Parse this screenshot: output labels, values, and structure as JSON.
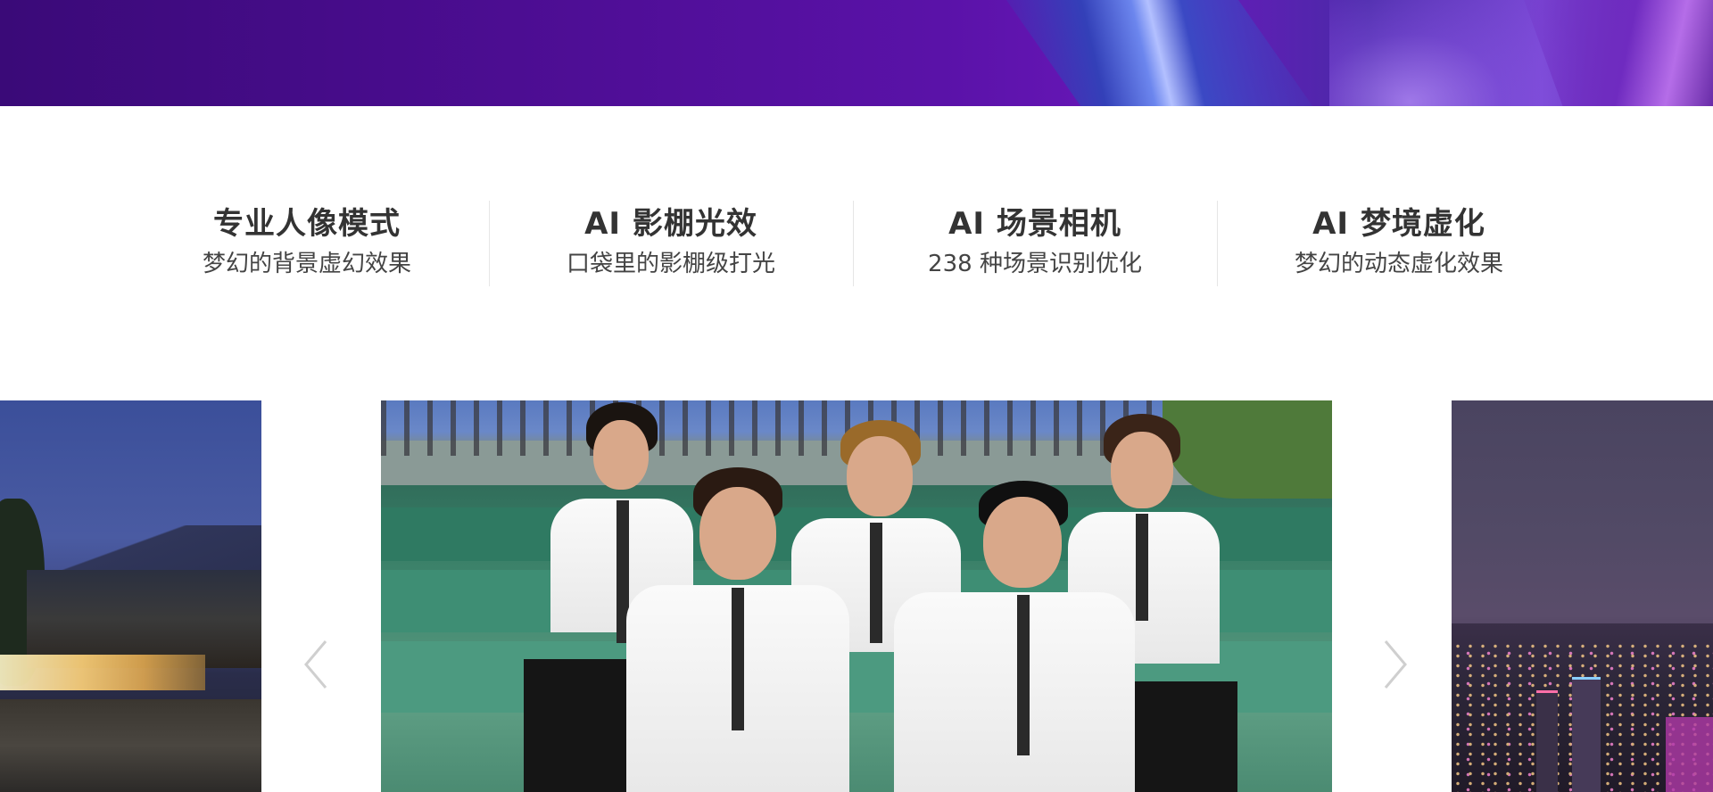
{
  "features": [
    {
      "title": "专业人像模式",
      "subtitle": "梦幻的背景虚幻效果"
    },
    {
      "title": "AI 影棚光效",
      "subtitle": "口袋里的影棚级打光"
    },
    {
      "title": "AI 场景相机",
      "subtitle": "238 种场景识别优化"
    },
    {
      "title": "AI 梦境虚化",
      "subtitle": "梦幻的动态虚化效果"
    }
  ],
  "carousel": {
    "prev_icon": "chevron-left-icon",
    "next_icon": "chevron-right-icon"
  },
  "colors": {
    "banner_purple": "#4c0d92",
    "divider": "#e6e6e6",
    "arrow": "#cfcfcf"
  }
}
